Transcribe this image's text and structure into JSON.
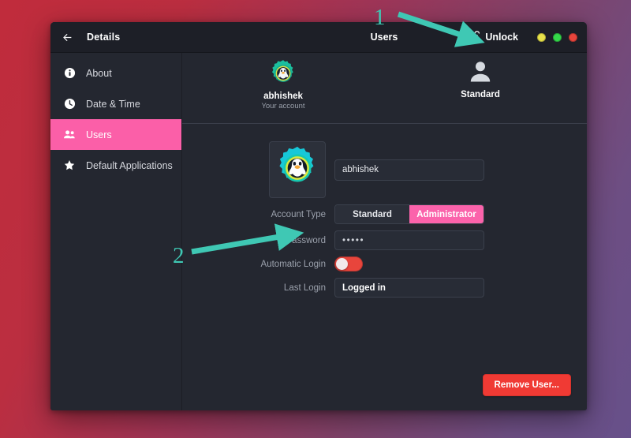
{
  "window": {
    "panel_title": "Details",
    "window_title": "Users",
    "back_icon": "arrow-left-icon",
    "unlock": {
      "label": "Unlock",
      "icon": "lock-open-icon"
    },
    "controls": [
      {
        "name": "minimize",
        "color": "#e8e24a"
      },
      {
        "name": "maximize",
        "color": "#34d94a"
      },
      {
        "name": "close",
        "color": "#e8453c"
      }
    ]
  },
  "sidebar": {
    "items": [
      {
        "label": "About",
        "icon": "info-icon",
        "active": false
      },
      {
        "label": "Date & Time",
        "icon": "clock-icon",
        "active": false
      },
      {
        "label": "Users",
        "icon": "users-icon",
        "active": true
      },
      {
        "label": "Default Applications",
        "icon": "star-icon",
        "active": false
      }
    ],
    "active_color": "#fb5fa8"
  },
  "users": [
    {
      "name": "abhishek",
      "subtitle": "Your account",
      "avatar": "gear-penguin-avatar",
      "selected": true
    },
    {
      "name": "Standard",
      "subtitle": "",
      "avatar": "person-icon",
      "selected": false
    }
  ],
  "form": {
    "avatar_icon": "gear-penguin-avatar",
    "username": {
      "value": "abhishek"
    },
    "account_type": {
      "label": "Account Type",
      "options": [
        "Standard",
        "Administrator"
      ],
      "selected": "Administrator"
    },
    "password": {
      "label": "Password",
      "value": "•••••"
    },
    "automatic_login": {
      "label": "Automatic Login",
      "enabled": false,
      "color": "#e8453c"
    },
    "last_login": {
      "label": "Last Login",
      "value": "Logged in"
    },
    "remove_button": "Remove User..."
  },
  "annotations": {
    "arrow_color": "#3fc8b4",
    "markers": [
      {
        "number": "1",
        "points_to": "unlock-button"
      },
      {
        "number": "2",
        "points_to": "password-field"
      }
    ]
  }
}
